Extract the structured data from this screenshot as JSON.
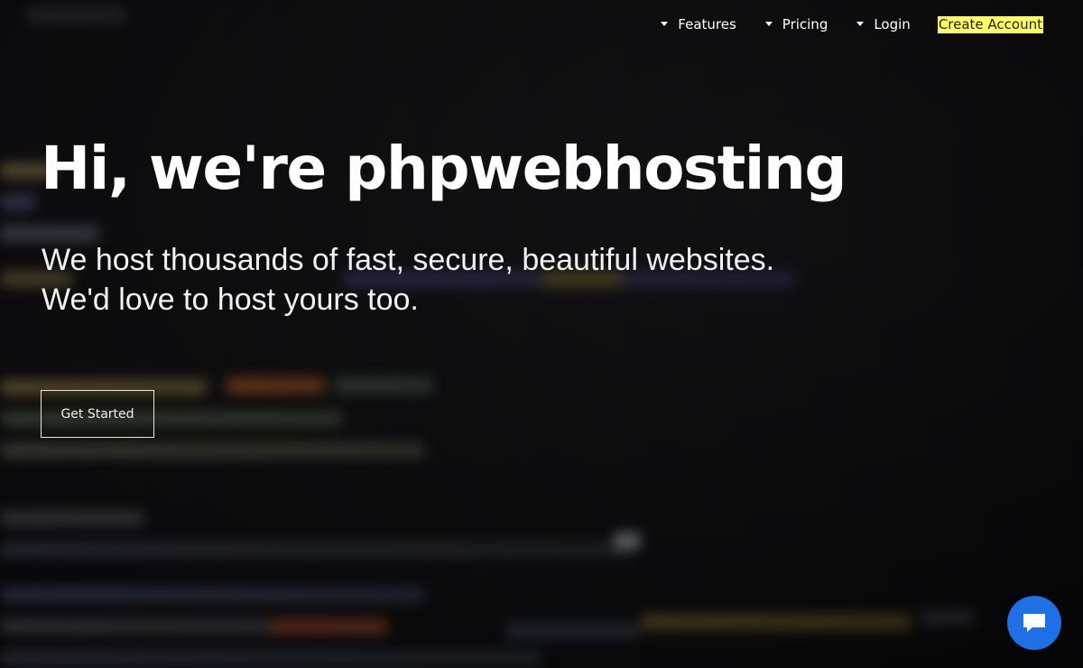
{
  "nav": {
    "items": [
      {
        "label": "Features"
      },
      {
        "label": "Pricing"
      },
      {
        "label": "Login"
      }
    ],
    "create_account": "Create Account"
  },
  "hero": {
    "headline": "Hi, we're phpwebhosting",
    "subline_1": "We host thousands of fast, secure, beautiful websites.",
    "subline_2": "We'd love to host yours too.",
    "cta_label": "Get Started"
  },
  "colors": {
    "highlight": "#ffff66",
    "chat_button": "#1f6fe5"
  },
  "icons": {
    "nav_caret": "caret-down-icon",
    "chat": "chat-bubble-icon"
  }
}
